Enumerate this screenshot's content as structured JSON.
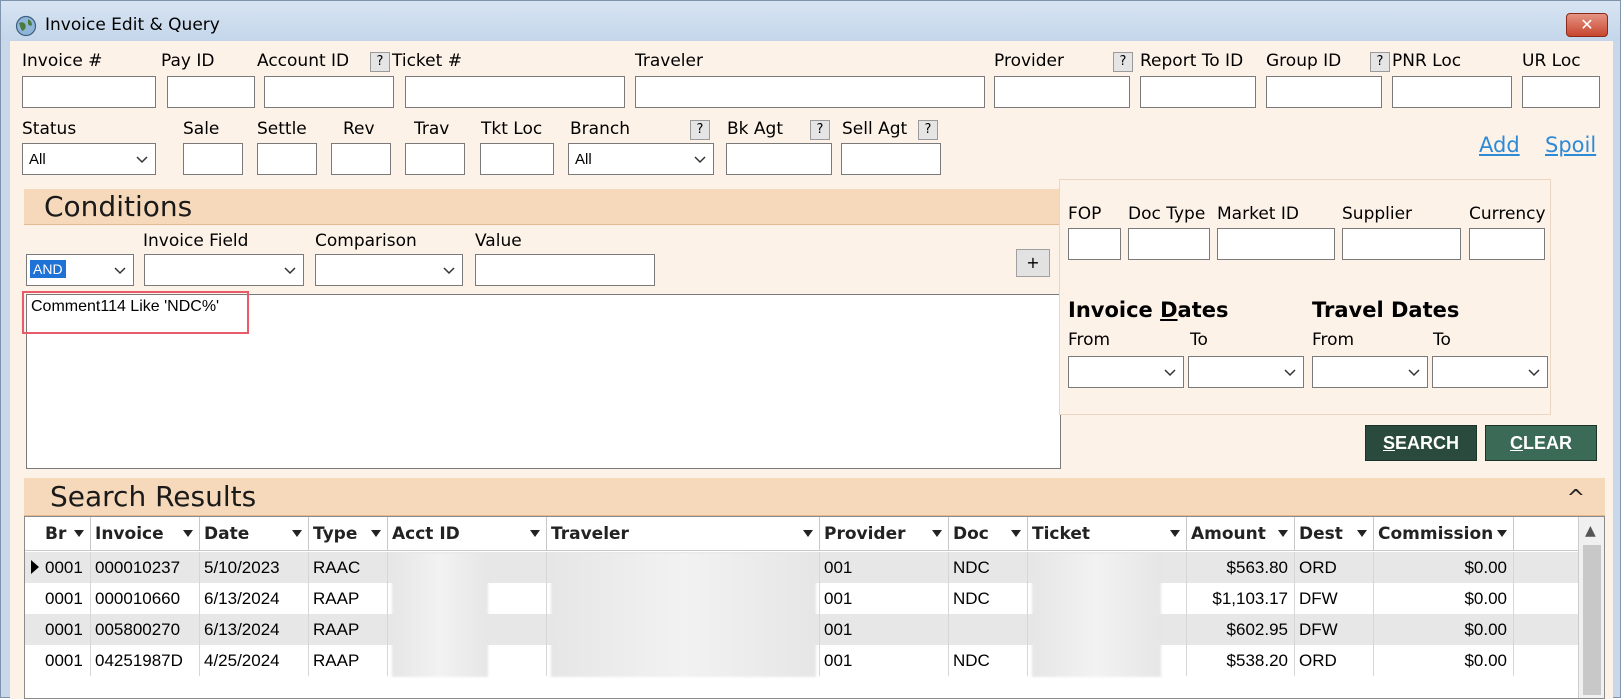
{
  "window": {
    "title": "Invoice Edit & Query",
    "close_label": "✕"
  },
  "top_fields": {
    "invoice_num": "Invoice #",
    "pay_id": "Pay ID",
    "account_id": "Account ID",
    "ticket_num": "Ticket #",
    "traveler": "Traveler",
    "provider": "Provider",
    "report_to_id": "Report To ID",
    "group_id": "Group ID",
    "pnr_loc": "PNR Loc",
    "ur_loc": "UR Loc",
    "status": "Status",
    "status_value": "All",
    "sale": "Sale",
    "settle": "Settle",
    "rev": "Rev",
    "trav": "Trav",
    "tkt_loc": "Tkt Loc",
    "branch": "Branch",
    "branch_value": "All",
    "bk_agt": "Bk Agt",
    "sell_agt": "Sell Agt",
    "q": "?"
  },
  "links": {
    "add": "Add",
    "spoil": "Spoil"
  },
  "conditions": {
    "title": "Conditions",
    "logic_value": "AND",
    "invoice_field": "Invoice Field",
    "comparison": "Comparison",
    "value": "Value",
    "plus": "+",
    "items": [
      "Comment114 Like 'NDC%'"
    ]
  },
  "right": {
    "fop": "FOP",
    "doc_type": "Doc Type",
    "market_id": "Market ID",
    "supplier": "Supplier",
    "currency": "Currency",
    "invoice_dates_pre": "Invoice ",
    "invoice_dates_u": "D",
    "invoice_dates_post": "ates",
    "travel_dates": "Travel Dates",
    "from": "From",
    "to": "To"
  },
  "buttons": {
    "search_u": "S",
    "search_rest": "EARCH",
    "clear_u": "C",
    "clear_rest": "LEAR"
  },
  "results": {
    "title": "Search Results",
    "collapse": "^",
    "columns": [
      "Br",
      "Invoice",
      "Date",
      "Type",
      "Acct ID",
      "Traveler",
      "Provider",
      "Doc",
      "Ticket",
      "Amount",
      "Dest",
      "Commission"
    ],
    "rows": [
      {
        "br": "0001",
        "invoice": "000010237",
        "date": "5/10/2023",
        "type": "RAAC",
        "provider": "001",
        "doc": "NDC",
        "amount": "$563.80",
        "dest": "ORD",
        "commission": "$0.00"
      },
      {
        "br": "0001",
        "invoice": "000010660",
        "date": "6/13/2024",
        "type": "RAAP",
        "provider": "001",
        "doc": "NDC",
        "amount": "$1,103.17",
        "dest": "DFW",
        "commission": "$0.00"
      },
      {
        "br": "0001",
        "invoice": "005800270",
        "date": "6/13/2024",
        "type": "RAAP",
        "provider": "001",
        "doc": "",
        "amount": "$602.95",
        "dest": "DFW",
        "commission": "$0.00"
      },
      {
        "br": "0001",
        "invoice": "04251987D",
        "date": "4/25/2024",
        "type": "RAAP",
        "provider": "001",
        "doc": "NDC",
        "amount": "$538.20",
        "dest": "ORD",
        "commission": "$0.00"
      }
    ]
  },
  "colors": {
    "accent_header": "#f6d9ba",
    "button_dark": "#2b4a3e",
    "link": "#2d8ad6",
    "highlight": "#e85b6a"
  }
}
